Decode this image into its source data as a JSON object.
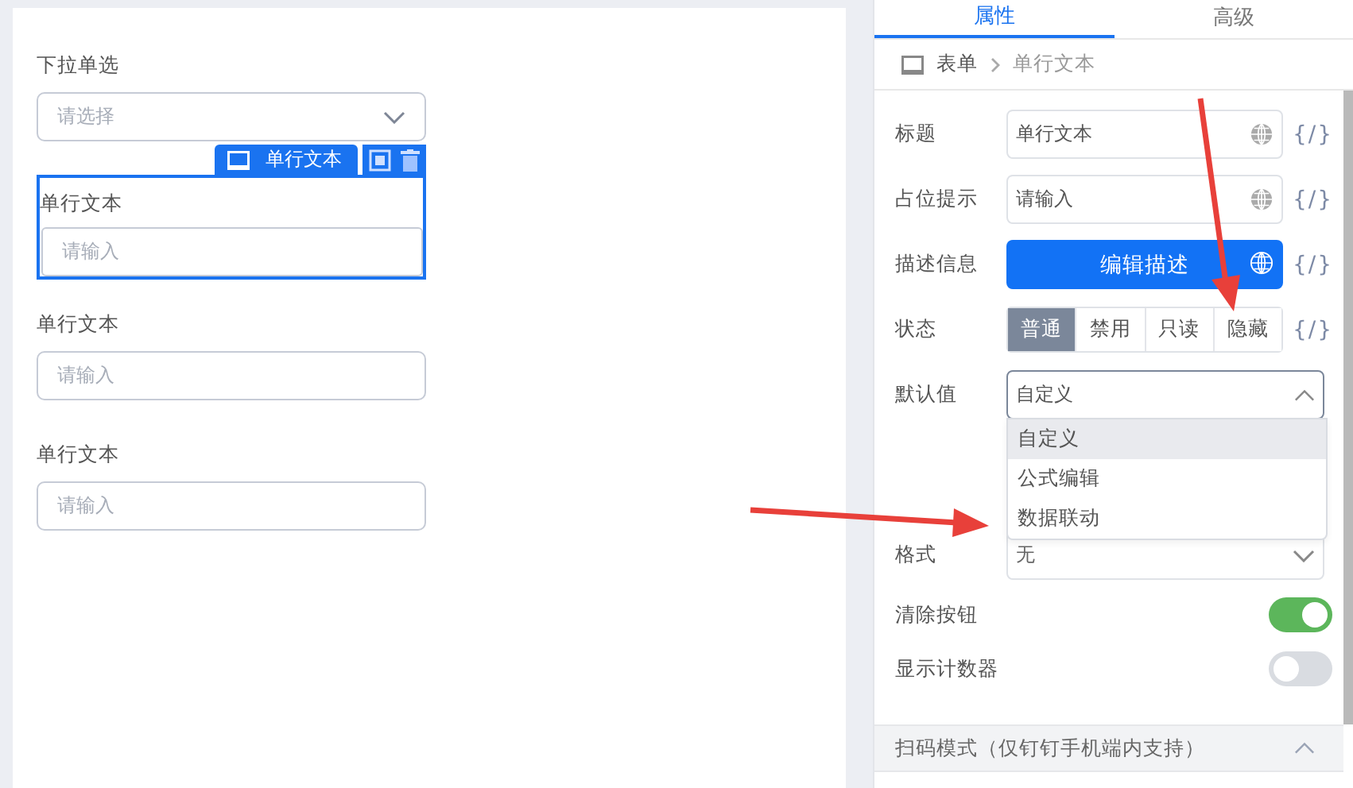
{
  "canvas": {
    "fields": [
      {
        "kind": "select",
        "label": "下拉单选",
        "placeholder": "请选择",
        "selected": false
      },
      {
        "kind": "text",
        "label": "单行文本",
        "placeholder": "请输入",
        "selected": true
      },
      {
        "kind": "text",
        "label": "单行文本",
        "placeholder": "请输入",
        "selected": false
      },
      {
        "kind": "text",
        "label": "单行文本",
        "placeholder": "请输入",
        "selected": false
      }
    ]
  },
  "selection_toolbar": {
    "label": "单行文本"
  },
  "panel": {
    "tabs": [
      {
        "label": "属性",
        "selected": true
      },
      {
        "label": "高级",
        "selected": false
      }
    ],
    "breadcrumb": [
      "表单",
      "单行文本"
    ],
    "rows": [
      {
        "kind": "input",
        "label": "标题",
        "value": "单行文本",
        "expression": "{/}"
      },
      {
        "kind": "input",
        "label": "占位提示",
        "value": "请输入",
        "expression": "{/}"
      },
      {
        "kind": "button",
        "label": "描述信息",
        "text": "编辑描述",
        "expression": "{/}"
      },
      {
        "kind": "segmented",
        "label": "状态",
        "expression": "{/}",
        "options": [
          {
            "label": "普通",
            "selected": true
          },
          {
            "label": "禁用",
            "selected": false
          },
          {
            "label": "只读",
            "selected": false
          },
          {
            "label": "隐藏",
            "selected": false
          }
        ]
      },
      {
        "kind": "select",
        "label": "默认值",
        "value": "自定义",
        "expanded": true,
        "options": [
          {
            "label": "自定义",
            "selected": true
          },
          {
            "label": "公式编辑",
            "selected": false
          },
          {
            "label": "数据联动",
            "selected": false
          }
        ]
      },
      {
        "kind": "select",
        "label": "格式",
        "value": "无",
        "expanded": false
      },
      {
        "kind": "switch",
        "label": "清除按钮",
        "on": true
      },
      {
        "kind": "switch",
        "label": "显示计数器",
        "on": false
      }
    ],
    "section": {
      "title": "扫码模式（仅钉钉手机端内支持）",
      "expanded": true
    }
  }
}
